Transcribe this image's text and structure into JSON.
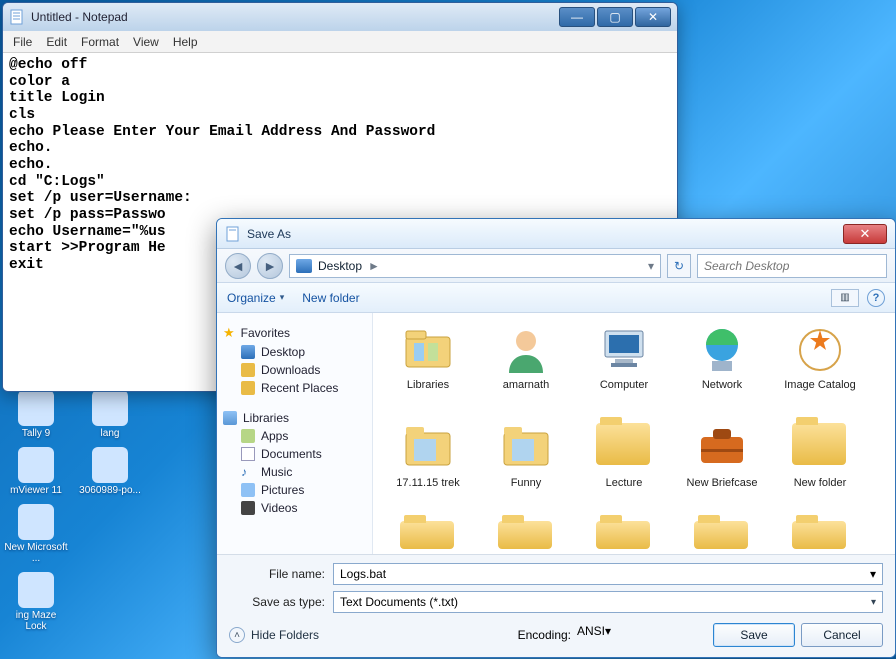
{
  "notepad": {
    "title": "Untitled - Notepad",
    "menu": [
      "File",
      "Edit",
      "Format",
      "View",
      "Help"
    ],
    "win_buttons": {
      "min": "—",
      "max": "▢",
      "close": "✕"
    },
    "content": "@echo off\ncolor a\ntitle Login\ncls\necho Please Enter Your Email Address And Password\necho.\necho.\ncd \"C:Logs\"\nset /p user=Username:\nset /p pass=Passwo\necho Username=\"%us\nstart >>Program He\nexit"
  },
  "saveas": {
    "title": "Save As",
    "close": "✕",
    "nav": {
      "back": "◄",
      "fwd": "►",
      "crumb_location": "Desktop",
      "crumb_chev": "►",
      "dd": "▾",
      "refresh": "↻",
      "search_placeholder": "Search Desktop"
    },
    "tool": {
      "organize": "Organize",
      "newfolder": "New folder",
      "view": "▥",
      "help": "?"
    },
    "side": {
      "favorites": {
        "header": "Favorites",
        "items": [
          "Desktop",
          "Downloads",
          "Recent Places"
        ]
      },
      "libraries": {
        "header": "Libraries",
        "items": [
          "Apps",
          "Documents",
          "Music",
          "Pictures",
          "Videos"
        ]
      }
    },
    "files": [
      {
        "name": "Libraries",
        "icon": "libraries"
      },
      {
        "name": "amarnath",
        "icon": "user"
      },
      {
        "name": "Computer",
        "icon": "computer"
      },
      {
        "name": "Network",
        "icon": "network"
      },
      {
        "name": "Image Catalog",
        "icon": "disc"
      },
      {
        "name": "17.11.15 trek",
        "icon": "photo1"
      },
      {
        "name": "Funny",
        "icon": "photo2"
      },
      {
        "name": "Lecture",
        "icon": "folder"
      },
      {
        "name": "New Briefcase",
        "icon": "briefcase"
      },
      {
        "name": "New folder",
        "icon": "folder"
      }
    ],
    "file_name_label": "File name:",
    "file_name_value": "Logs.bat",
    "save_type_label": "Save as type:",
    "save_type_value": "Text Documents (*.txt)",
    "hide_folders": "Hide Folders",
    "encoding_label": "Encoding:",
    "encoding_value": "ANSI",
    "save": "Save",
    "cancel": "Cancel"
  },
  "desktop_icons": [
    {
      "label": "Tally 9"
    },
    {
      "label": "lang"
    },
    {
      "label": "mViewer 11"
    },
    {
      "label": "3060989-po..."
    },
    {
      "label": "New Microsoft ..."
    },
    {
      "label": ""
    },
    {
      "label": "ing Maze Lock"
    },
    {
      "label": ""
    }
  ]
}
